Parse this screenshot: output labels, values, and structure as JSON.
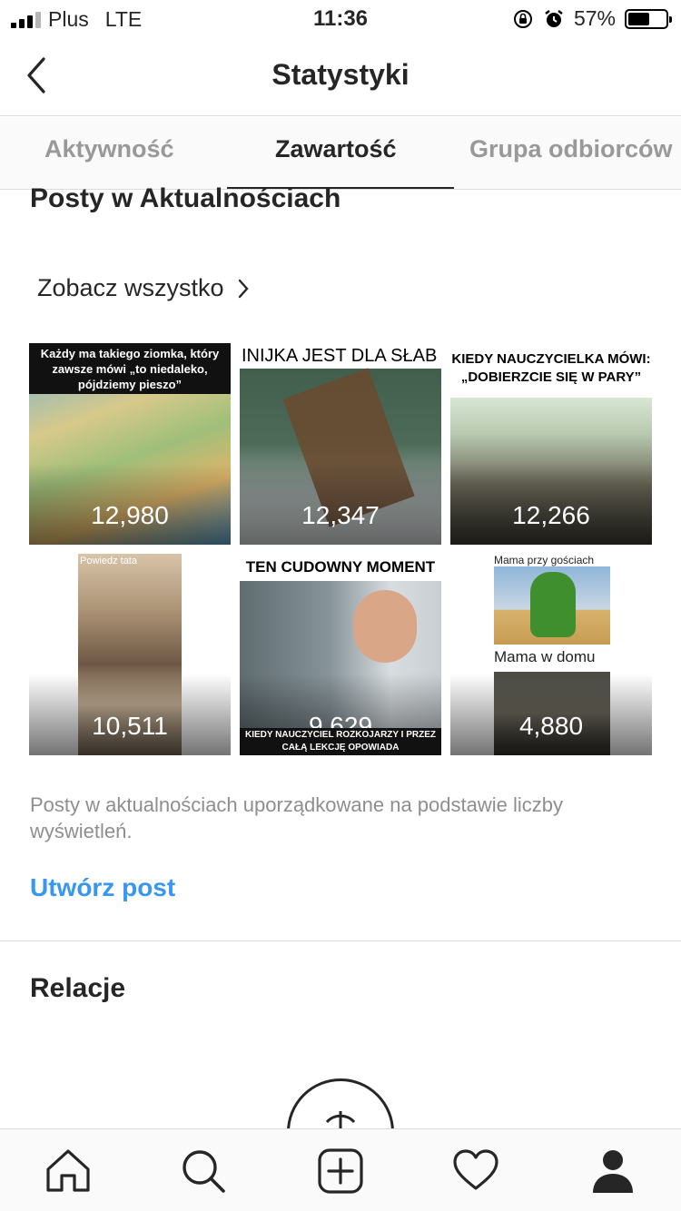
{
  "status_bar": {
    "carrier": "Plus",
    "network": "LTE",
    "time": "11:36",
    "battery": "57%",
    "battery_level": 0.57
  },
  "header": {
    "title": "Statystyki"
  },
  "tabs": [
    {
      "label": "Aktywność",
      "active": false
    },
    {
      "label": "Zawartość",
      "active": true
    },
    {
      "label": "Grupa odbiorców",
      "active": false
    }
  ],
  "posts_section": {
    "title": "Posty w Aktualnościach",
    "see_all": "Zobacz wszystko",
    "posts": [
      {
        "views": "12,980",
        "caption": "Każdy ma takiego ziomka, który zawsze mówi „to niedaleko, pójdziemy pieszo”"
      },
      {
        "views": "12,347",
        "caption": "INIJKA JEST DLA SŁAB"
      },
      {
        "views": "12,266",
        "caption": "KIEDY NAUCZYCIELKA MÓWI: „DOBIERZCIE SIĘ W PARY”"
      },
      {
        "views": "10,511",
        "caption": "Powiedz tata"
      },
      {
        "views": "9,629",
        "caption": "TEN CUDOWNY MOMENT",
        "footer": "KIEDY NAUCZYCIEL ROZKOJARZY I PRZEZ CAŁĄ LEKCJĘ OPOWIADA"
      },
      {
        "views": "4,880",
        "caption": "Mama przy gościach",
        "footer": "Mama w domu"
      }
    ],
    "description": "Posty w aktualnościach uporządkowane na podstawie liczby wyświetleń.",
    "create_post": "Utwórz post"
  },
  "stories_section": {
    "title": "Relacje"
  },
  "bottom_nav": [
    "home-icon",
    "search-icon",
    "add-post-icon",
    "activity-heart-icon",
    "profile-icon"
  ]
}
